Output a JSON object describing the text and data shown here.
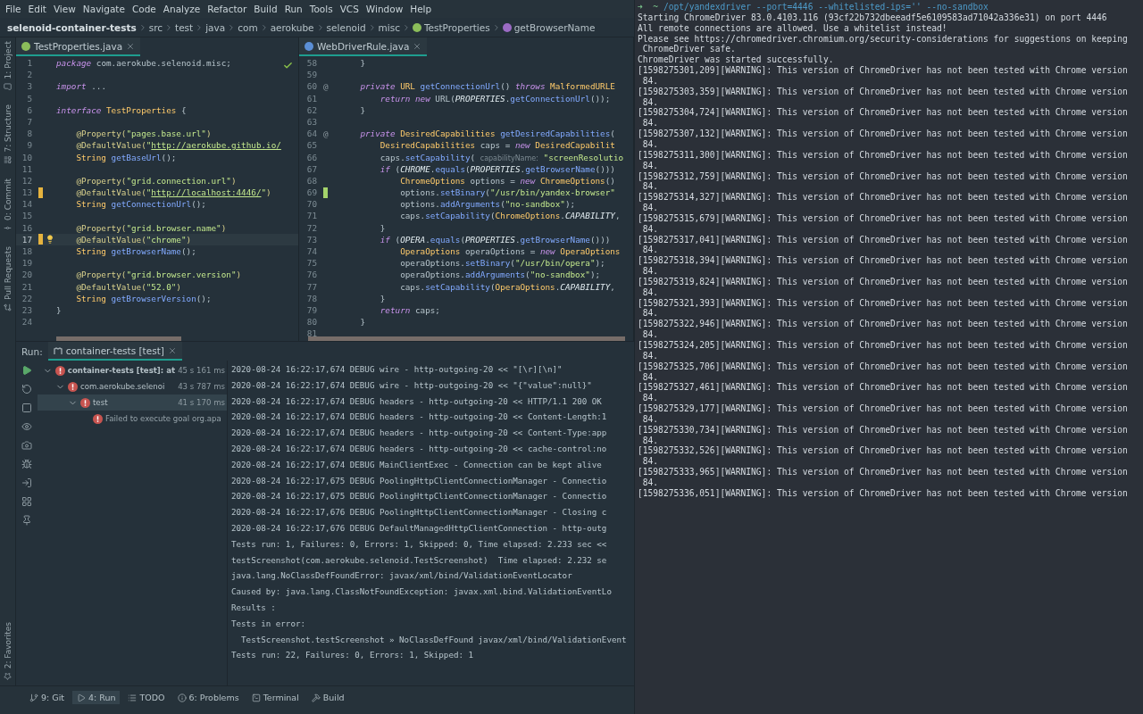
{
  "menu": [
    "File",
    "Edit",
    "View",
    "Navigate",
    "Code",
    "Analyze",
    "Refactor",
    "Build",
    "Run",
    "Tools",
    "VCS",
    "Window",
    "Help"
  ],
  "breadcrumb": [
    {
      "label": "selenoid-container-tests"
    },
    {
      "label": "src"
    },
    {
      "label": "test"
    },
    {
      "label": "java"
    },
    {
      "label": "com"
    },
    {
      "label": "aerokube"
    },
    {
      "label": "selenoid"
    },
    {
      "label": "misc"
    },
    {
      "label": "TestProperties"
    },
    {
      "label": "getBrowserName"
    }
  ],
  "side_tools": [
    {
      "label": "1: Project"
    },
    {
      "label": "7: Structure"
    },
    {
      "label": "0: Commit"
    },
    {
      "label": "Pull Requests"
    },
    {
      "label": "2: Favorites"
    }
  ],
  "editors": [
    {
      "tab": {
        "label": "TestProperties.java",
        "selected": true
      },
      "inspection_ok": true,
      "lines": [
        {
          "number": "1",
          "tokens": [
            {
              "kind": "keyword",
              "text": "package"
            },
            {
              "kind": "plain",
              "text": " com.aerokube.selenoid.misc;"
            }
          ]
        },
        {
          "number": "2"
        },
        {
          "number": "3",
          "tokens": [
            {
              "kind": "keyword",
              "text": "import"
            },
            {
              "kind": "plain",
              "text": " ..."
            }
          ]
        },
        {
          "number": "5"
        },
        {
          "number": "6",
          "tokens": [
            {
              "kind": "keyword",
              "text": "interface"
            },
            {
              "kind": "type",
              "text": " TestProperties"
            },
            {
              "kind": "plain",
              "text": " {"
            }
          ]
        },
        {
          "number": "7"
        },
        {
          "number": "8",
          "tokens": [
            {
              "kind": "annotation",
              "text": "    @Property("
            },
            {
              "kind": "string",
              "text": "\"pages.base.url\""
            },
            {
              "kind": "annotation",
              "text": ")"
            }
          ]
        },
        {
          "number": "9",
          "tokens": [
            {
              "kind": "annotation",
              "text": "    @DefaultValue("
            },
            {
              "kind": "string",
              "text": "\""
            },
            {
              "kind": "url",
              "text": "http://aerokube.github.io/"
            }
          ]
        },
        {
          "number": "10",
          "tokens": [
            {
              "kind": "type",
              "text": "    String"
            },
            {
              "kind": "method",
              "text": " getBaseUrl"
            },
            {
              "kind": "plain",
              "text": "();"
            }
          ]
        },
        {
          "number": "11"
        },
        {
          "number": "12",
          "tokens": [
            {
              "kind": "annotation",
              "text": "    @Property("
            },
            {
              "kind": "string",
              "text": "\"grid.connection.url\""
            },
            {
              "kind": "annotation",
              "text": ")"
            }
          ]
        },
        {
          "number": "13",
          "color": "#e6b33e",
          "tokens": [
            {
              "kind": "annotation",
              "text": "    @DefaultValue("
            },
            {
              "kind": "string",
              "text": "\""
            },
            {
              "kind": "url",
              "text": "http://localhost:4446/"
            },
            {
              "kind": "string",
              "text": "\""
            },
            {
              "kind": "annotation",
              "text": ")"
            }
          ]
        },
        {
          "number": "14",
          "tokens": [
            {
              "kind": "type",
              "text": "    String"
            },
            {
              "kind": "method",
              "text": " getConnectionUrl"
            },
            {
              "kind": "plain",
              "text": "();"
            }
          ]
        },
        {
          "number": "15"
        },
        {
          "number": "16",
          "tokens": [
            {
              "kind": "annotation",
              "text": "    @Property("
            },
            {
              "kind": "string",
              "text": "\"grid.browser.name\""
            },
            {
              "kind": "annotation",
              "text": ")"
            }
          ]
        },
        {
          "number": "17",
          "color": "#e6b33e",
          "current": true,
          "intention": true,
          "tokens": [
            {
              "kind": "annotation",
              "text": "    @DefaultValue("
            },
            {
              "kind": "string",
              "text": "\"chrome\""
            },
            {
              "kind": "annotation",
              "text": ")"
            }
          ]
        },
        {
          "number": "18",
          "tokens": [
            {
              "kind": "type",
              "text": "    String"
            },
            {
              "kind": "method",
              "text": " getBrowserName"
            },
            {
              "kind": "plain",
              "text": "();"
            }
          ]
        },
        {
          "number": "19"
        },
        {
          "number": "20",
          "tokens": [
            {
              "kind": "annotation",
              "text": "    @Property("
            },
            {
              "kind": "string",
              "text": "\"grid.browser.version\""
            },
            {
              "kind": "annotation",
              "text": ")"
            }
          ]
        },
        {
          "number": "21",
          "tokens": [
            {
              "kind": "annotation",
              "text": "    @DefaultValue("
            },
            {
              "kind": "string",
              "text": "\"52.0\""
            },
            {
              "kind": "annotation",
              "text": ")"
            }
          ]
        },
        {
          "number": "22",
          "tokens": [
            {
              "kind": "type",
              "text": "    String"
            },
            {
              "kind": "method",
              "text": " getBrowserVersion"
            },
            {
              "kind": "plain",
              "text": "();"
            }
          ]
        },
        {
          "number": "23",
          "tokens": [
            {
              "kind": "plain",
              "text": "}"
            }
          ]
        },
        {
          "number": "24"
        }
      ]
    },
    {
      "tab": {
        "label": "WebDriverRule.java",
        "selected": true
      },
      "lines": [
        {
          "number": "58",
          "tokens": [
            {
              "kind": "plain",
              "text": "    }"
            }
          ]
        },
        {
          "number": "59"
        },
        {
          "number": "60",
          "gutter": "@",
          "tokens": [
            {
              "kind": "keyword",
              "text": "    private"
            },
            {
              "kind": "type",
              "text": " URL"
            },
            {
              "kind": "method",
              "text": " getConnectionUrl"
            },
            {
              "kind": "plain",
              "text": "() "
            },
            {
              "kind": "keyword",
              "text": "throws"
            },
            {
              "kind": "type",
              "text": " MalformedURLE"
            }
          ]
        },
        {
          "number": "61",
          "tokens": [
            {
              "kind": "keyword",
              "text": "        return new"
            },
            {
              "kind": "plain",
              "text": " URL("
            },
            {
              "kind": "constant",
              "text": "PROPERTIES"
            },
            {
              "kind": "plain",
              "text": "."
            },
            {
              "kind": "method",
              "text": "getConnectionUrl"
            },
            {
              "kind": "plain",
              "text": "());"
            }
          ]
        },
        {
          "number": "62",
          "tokens": [
            {
              "kind": "plain",
              "text": "    }"
            }
          ]
        },
        {
          "number": "63"
        },
        {
          "number": "64",
          "gutter": "@",
          "tokens": [
            {
              "kind": "keyword",
              "text": "    private"
            },
            {
              "kind": "type",
              "text": " DesiredCapabilities"
            },
            {
              "kind": "method",
              "text": " getDesiredCapabilities"
            },
            {
              "kind": "plain",
              "text": "("
            }
          ]
        },
        {
          "number": "65",
          "tokens": [
            {
              "kind": "type",
              "text": "        DesiredCapabilities"
            },
            {
              "kind": "plain",
              "text": " caps = "
            },
            {
              "kind": "keyword",
              "text": "new"
            },
            {
              "kind": "type",
              "text": " DesiredCapabilit"
            }
          ]
        },
        {
          "number": "66",
          "tokens": [
            {
              "kind": "plain",
              "text": "        caps."
            },
            {
              "kind": "method",
              "text": "setCapability"
            },
            {
              "kind": "plain",
              "text": "( "
            },
            {
              "kind": "hint",
              "text": "capabilityName:"
            },
            {
              "kind": "string",
              "text": " \"screenResolutio"
            }
          ]
        },
        {
          "number": "67",
          "tokens": [
            {
              "kind": "keyword",
              "text": "        if"
            },
            {
              "kind": "plain",
              "text": " ("
            },
            {
              "kind": "constant",
              "text": "CHROME"
            },
            {
              "kind": "plain",
              "text": "."
            },
            {
              "kind": "method",
              "text": "equals"
            },
            {
              "kind": "plain",
              "text": "("
            },
            {
              "kind": "constant",
              "text": "PROPERTIES"
            },
            {
              "kind": "plain",
              "text": "."
            },
            {
              "kind": "method",
              "text": "getBrowserName"
            },
            {
              "kind": "plain",
              "text": "()))"
            }
          ]
        },
        {
          "number": "68",
          "tokens": [
            {
              "kind": "type",
              "text": "            ChromeOptions"
            },
            {
              "kind": "plain",
              "text": " options = "
            },
            {
              "kind": "keyword",
              "text": "new"
            },
            {
              "kind": "type",
              "text": " ChromeOptions"
            },
            {
              "kind": "plain",
              "text": "()"
            }
          ]
        },
        {
          "number": "69",
          "color": "#a4d36b",
          "tokens": [
            {
              "kind": "plain",
              "text": "            options."
            },
            {
              "kind": "method",
              "text": "setBinary"
            },
            {
              "kind": "plain",
              "text": "("
            },
            {
              "kind": "string",
              "text": "\"/usr/bin/yandex-browser\""
            }
          ]
        },
        {
          "number": "70",
          "tokens": [
            {
              "kind": "plain",
              "text": "            options."
            },
            {
              "kind": "method",
              "text": "addArguments"
            },
            {
              "kind": "plain",
              "text": "("
            },
            {
              "kind": "string",
              "text": "\"no-sandbox\""
            },
            {
              "kind": "plain",
              "text": ");"
            }
          ]
        },
        {
          "number": "71",
          "tokens": [
            {
              "kind": "plain",
              "text": "            caps."
            },
            {
              "kind": "method",
              "text": "setCapability"
            },
            {
              "kind": "plain",
              "text": "("
            },
            {
              "kind": "type",
              "text": "ChromeOptions"
            },
            {
              "kind": "plain",
              "text": "."
            },
            {
              "kind": "constant",
              "text": "CAPABILITY"
            },
            {
              "kind": "plain",
              "text": ","
            }
          ]
        },
        {
          "number": "72",
          "tokens": [
            {
              "kind": "plain",
              "text": "        }"
            }
          ]
        },
        {
          "number": "73",
          "tokens": [
            {
              "kind": "keyword",
              "text": "        if"
            },
            {
              "kind": "plain",
              "text": " ("
            },
            {
              "kind": "constant",
              "text": "OPERA"
            },
            {
              "kind": "plain",
              "text": "."
            },
            {
              "kind": "method",
              "text": "equals"
            },
            {
              "kind": "plain",
              "text": "("
            },
            {
              "kind": "constant",
              "text": "PROPERTIES"
            },
            {
              "kind": "plain",
              "text": "."
            },
            {
              "kind": "method",
              "text": "getBrowserName"
            },
            {
              "kind": "plain",
              "text": "()))"
            }
          ]
        },
        {
          "number": "74",
          "tokens": [
            {
              "kind": "type",
              "text": "            OperaOptions"
            },
            {
              "kind": "plain",
              "text": " operaOptions = "
            },
            {
              "kind": "keyword",
              "text": "new"
            },
            {
              "kind": "type",
              "text": " OperaOptions"
            }
          ]
        },
        {
          "number": "75",
          "tokens": [
            {
              "kind": "plain",
              "text": "            operaOptions."
            },
            {
              "kind": "method",
              "text": "setBinary"
            },
            {
              "kind": "plain",
              "text": "("
            },
            {
              "kind": "string",
              "text": "\"/usr/bin/opera\""
            },
            {
              "kind": "plain",
              "text": ");"
            }
          ]
        },
        {
          "number": "76",
          "tokens": [
            {
              "kind": "plain",
              "text": "            operaOptions."
            },
            {
              "kind": "method",
              "text": "addArguments"
            },
            {
              "kind": "plain",
              "text": "("
            },
            {
              "kind": "string",
              "text": "\"no-sandbox\""
            },
            {
              "kind": "plain",
              "text": ");"
            }
          ]
        },
        {
          "number": "77",
          "tokens": [
            {
              "kind": "plain",
              "text": "            caps."
            },
            {
              "kind": "method",
              "text": "setCapability"
            },
            {
              "kind": "plain",
              "text": "("
            },
            {
              "kind": "type",
              "text": "OperaOptions"
            },
            {
              "kind": "plain",
              "text": "."
            },
            {
              "kind": "constant",
              "text": "CAPABILITY"
            },
            {
              "kind": "plain",
              "text": ","
            }
          ]
        },
        {
          "number": "78",
          "tokens": [
            {
              "kind": "plain",
              "text": "        }"
            }
          ]
        },
        {
          "number": "79",
          "tokens": [
            {
              "kind": "keyword",
              "text": "        return"
            },
            {
              "kind": "plain",
              "text": " caps;"
            }
          ]
        },
        {
          "number": "80",
          "tokens": [
            {
              "kind": "plain",
              "text": "    }"
            }
          ]
        },
        {
          "number": "81"
        }
      ]
    }
  ],
  "run": {
    "label": "Run:",
    "tab": {
      "label": "container-tests [test]",
      "selected": true
    },
    "tree": [
      {
        "label": "container-tests [test]: at",
        "time": "45 s 161 ms",
        "failed": true,
        "expanded": true,
        "selected": false,
        "children": [
          {
            "label": "com.aerokube.selenoi",
            "time": "43 s 787 ms",
            "failed": true,
            "expanded": true,
            "selected": false,
            "children": [
              {
                "label": "test",
                "time": "41 s 170 ms",
                "failed": true,
                "expanded": true,
                "selected": true,
                "children": [
                  {
                    "label": "Failed to execute goal org.apa",
                    "failed": true,
                    "selected": false
                  }
                ]
              }
            ]
          }
        ]
      }
    ],
    "log": [
      "2020-08-24 16:22:17,674 DEBUG wire - http-outgoing-20 << \"[\\r][\\n]\"",
      "2020-08-24 16:22:17,674 DEBUG wire - http-outgoing-20 << \"{\"value\":null}\"",
      "2020-08-24 16:22:17,674 DEBUG headers - http-outgoing-20 << HTTP/1.1 200 OK",
      "2020-08-24 16:22:17,674 DEBUG headers - http-outgoing-20 << Content-Length:1",
      "2020-08-24 16:22:17,674 DEBUG headers - http-outgoing-20 << Content-Type:app",
      "2020-08-24 16:22:17,674 DEBUG headers - http-outgoing-20 << cache-control:no",
      "2020-08-24 16:22:17,674 DEBUG MainClientExec - Connection can be kept alive",
      "2020-08-24 16:22:17,675 DEBUG PoolingHttpClientConnectionManager - Connectio",
      "2020-08-24 16:22:17,675 DEBUG PoolingHttpClientConnectionManager - Connectio",
      "2020-08-24 16:22:17,676 DEBUG PoolingHttpClientConnectionManager - Closing c",
      "2020-08-24 16:22:17,676 DEBUG DefaultManagedHttpClientConnection - http-outg",
      "Tests run: 1, Failures: 0, Errors: 1, Skipped: 0, Time elapsed: 2.233 sec <<",
      "testScreenshot(com.aerokube.selenoid.TestScreenshot)  Time elapsed: 2.232 se",
      "java.lang.NoClassDefFoundError: javax/xml/bind/ValidationEventLocator",
      "Caused by: java.lang.ClassNotFoundException: javax.xml.bind.ValidationEventLo",
      "Results :",
      "Tests in error:",
      "  TestScreenshot.testScreenshot » NoClassDefFound javax/xml/bind/ValidationEvent",
      "Tests run: 22, Failures: 0, Errors: 1, Skipped: 1"
    ]
  },
  "bottom_tools": [
    {
      "label": "9: Git",
      "selected": false
    },
    {
      "label": "4: Run",
      "selected": true
    },
    {
      "label": "TODO",
      "selected": false
    },
    {
      "label": "6: Problems",
      "selected": false
    },
    {
      "label": "Terminal",
      "selected": false
    },
    {
      "label": "Build",
      "selected": false
    }
  ],
  "terminal": {
    "prompt": "➜",
    "directory": "~",
    "command": "/opt/yandexdriver --port=4446 --whitelisted-ips='' --no-sandbox",
    "output": [
      "Starting ChromeDriver 83.0.4103.116 (93cf22b732dbeeadf5e6109583ad71042a336e31) on port 4446",
      "All remote connections are allowed. Use a whitelist instead!",
      "Please see https://chromedriver.chromium.org/security-considerations for suggestions on keeping",
      " ChromeDriver safe.",
      "ChromeDriver was started successfully.",
      "[1598275301,209][WARNING]: This version of ChromeDriver has not been tested with Chrome version",
      " 84.",
      "[1598275303,359][WARNING]: This version of ChromeDriver has not been tested with Chrome version",
      " 84.",
      "[1598275304,724][WARNING]: This version of ChromeDriver has not been tested with Chrome version",
      " 84.",
      "[1598275307,132][WARNING]: This version of ChromeDriver has not been tested with Chrome version",
      " 84.",
      "[1598275311,300][WARNING]: This version of ChromeDriver has not been tested with Chrome version",
      " 84.",
      "[1598275312,759][WARNING]: This version of ChromeDriver has not been tested with Chrome version",
      " 84.",
      "[1598275314,327][WARNING]: This version of ChromeDriver has not been tested with Chrome version",
      " 84.",
      "[1598275315,679][WARNING]: This version of ChromeDriver has not been tested with Chrome version",
      " 84.",
      "[1598275317,041][WARNING]: This version of ChromeDriver has not been tested with Chrome version",
      " 84.",
      "[1598275318,394][WARNING]: This version of ChromeDriver has not been tested with Chrome version",
      " 84.",
      "[1598275319,824][WARNING]: This version of ChromeDriver has not been tested with Chrome version",
      " 84.",
      "[1598275321,393][WARNING]: This version of ChromeDriver has not been tested with Chrome version",
      " 84.",
      "[1598275322,946][WARNING]: This version of ChromeDriver has not been tested with Chrome version",
      " 84.",
      "[1598275324,205][WARNING]: This version of ChromeDriver has not been tested with Chrome version",
      " 84.",
      "[1598275325,706][WARNING]: This version of ChromeDriver has not been tested with Chrome version",
      " 84.",
      "[1598275327,461][WARNING]: This version of ChromeDriver has not been tested with Chrome version",
      " 84.",
      "[1598275329,177][WARNING]: This version of ChromeDriver has not been tested with Chrome version",
      " 84.",
      "[1598275330,734][WARNING]: This version of ChromeDriver has not been tested with Chrome version",
      " 84.",
      "[1598275332,526][WARNING]: This version of ChromeDriver has not been tested with Chrome version",
      " 84.",
      "[1598275333,965][WARNING]: This version of ChromeDriver has not been tested with Chrome version",
      " 84.",
      "[1598275336,051][WARNING]: This version of ChromeDriver has not been tested with Chrome version"
    ]
  }
}
